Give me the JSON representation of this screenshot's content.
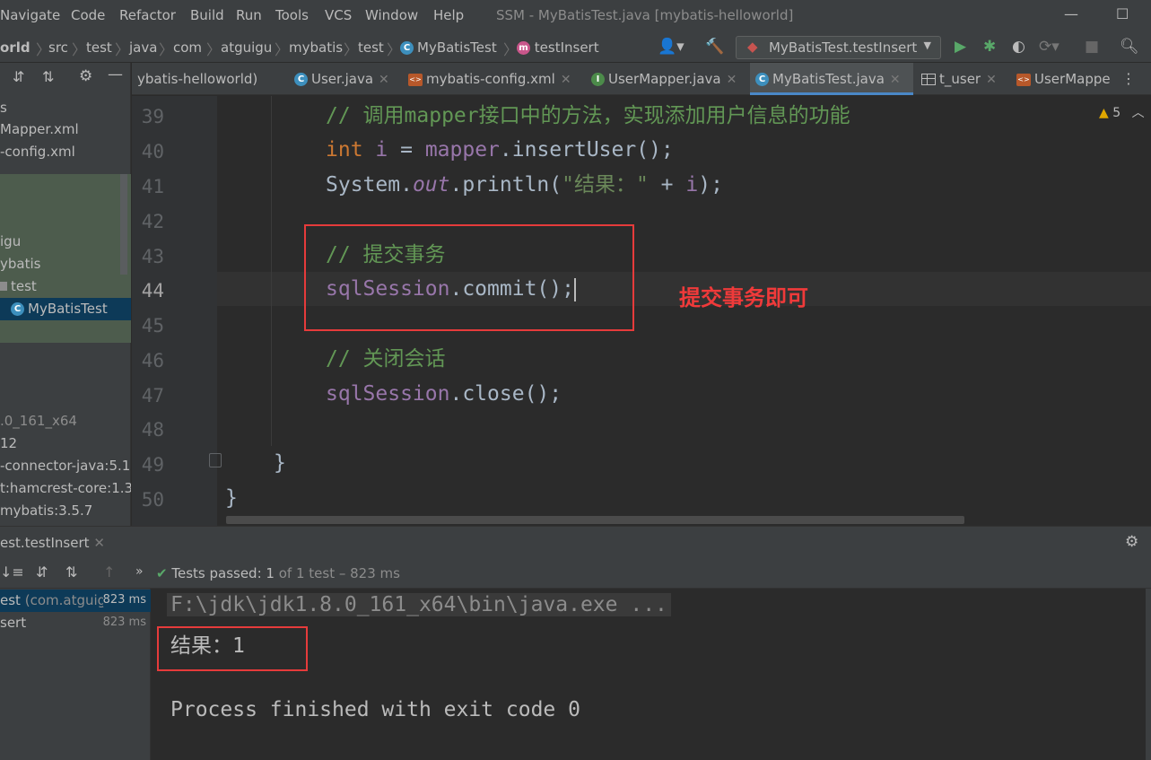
{
  "menu": {
    "items": [
      "Navigate",
      "Code",
      "Refactor",
      "Build",
      "Run",
      "Tools",
      "VCS",
      "Window",
      "Help"
    ],
    "window_title": "SSM - MyBatisTest.java [mybatis-helloworld]"
  },
  "breadcrumb": {
    "items": [
      "orld",
      "src",
      "test",
      "java",
      "com",
      "atguigu",
      "mybatis",
      "test",
      "MyBatisTest",
      "testInsert"
    ]
  },
  "run_config": {
    "label": "MyBatisTest.testInsert"
  },
  "project_tree": {
    "items": [
      "s",
      "Mapper.xml",
      "-config.xml",
      "igu",
      "ybatis",
      "test",
      "MyBatisTest",
      ".0_161_x64",
      "12",
      "-connector-java:5.1.",
      "t:hamcrest-core:1.3",
      "mybatis:3.5.7"
    ]
  },
  "editor_tabs": [
    {
      "label": "ybatis-helloworld)",
      "icon": "module-icon"
    },
    {
      "label": "User.java",
      "icon": "class-icon"
    },
    {
      "label": "mybatis-config.xml",
      "icon": "xml-icon"
    },
    {
      "label": "UserMapper.java",
      "icon": "interface-icon"
    },
    {
      "label": "MyBatisTest.java",
      "icon": "class-icon",
      "active": true
    },
    {
      "label": "t_user",
      "icon": "table-icon"
    },
    {
      "label": "UserMappe",
      "icon": "xml-icon"
    }
  ],
  "editor": {
    "warnings": "5",
    "line_numbers": [
      "39",
      "40",
      "41",
      "42",
      "43",
      "44",
      "45",
      "46",
      "47",
      "48",
      "49",
      "50"
    ],
    "lines": {
      "l39_comment": "// 调用mapper接口中的方法，实现添加用户信息的功能",
      "l40_kw": "int",
      "l40_var": "i",
      "l40_eq": " = ",
      "l40_obj": "mapper",
      "l40_rest": ".insertUser();",
      "l41_a": "System.",
      "l41_out": "out",
      "l41_b": ".println(",
      "l41_str": "\"结果：\"",
      "l41_c": " + ",
      "l41_var": "i",
      "l41_d": ");",
      "l43_comment": "// 提交事务",
      "l44_obj": "sqlSession",
      "l44_rest": ".commit();",
      "l46_comment": "// 关闭会话",
      "l47_obj": "sqlSession",
      "l47_rest": ".close();",
      "l49": "}",
      "l50": "}"
    },
    "annotation": "提交事务即可"
  },
  "run_panel": {
    "tab_label": "est.testInsert",
    "status_passed": "Tests passed:",
    "status_count": "1",
    "status_rest": "of 1 test – 823 ms",
    "tree": [
      {
        "label": "est",
        "sub": "(com.atguig",
        "time": "823 ms"
      },
      {
        "label": "sert",
        "sub": "",
        "time": "823 ms"
      }
    ],
    "console": {
      "cmd": "F:\\jdk\\jdk1.8.0_161_x64\\bin\\java.exe ...",
      "result": "结果：1",
      "exit": "Process finished with exit code 0"
    }
  }
}
